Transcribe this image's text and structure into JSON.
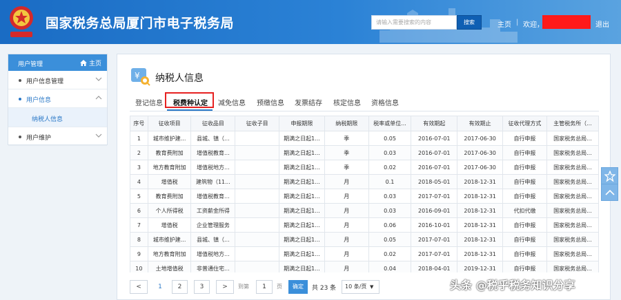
{
  "header": {
    "title": "国家税务总局厦门市电子税务局",
    "search_placeholder": "请输入需要搜索的内容",
    "search_button": "搜索",
    "home_link": "主页",
    "welcome": "欢迎，",
    "logout": "退出",
    "separator": "|"
  },
  "sidebar": {
    "header_label": "用户管理",
    "home_label": "主页",
    "items": [
      {
        "label": "用户信息管理"
      },
      {
        "label": "用户信息"
      },
      {
        "label": "纳税人信息"
      },
      {
        "label": "用户维护"
      }
    ]
  },
  "panel": {
    "title": "纳税人信息",
    "tabs": [
      "登记信息",
      "税费种认定",
      "减免信息",
      "预缴信息",
      "发票结存",
      "核定信息",
      "资格信息"
    ],
    "active_tab": "税费种认定"
  },
  "table": {
    "columns": [
      "序号",
      "征收项目",
      "征收品目",
      "征收子目",
      "申报期限",
      "纳税期限",
      "税率或单位...",
      "有效期起",
      "有效期止",
      "征收代理方式",
      "主管税务所（..."
    ],
    "rows": [
      [
        "1",
        "城市维护建...",
        "县城、镇（...",
        "",
        "期满之日起1...",
        "季",
        "0.05",
        "2016-07-01",
        "2017-06-30",
        "自行申报",
        "国家税务总局..."
      ],
      [
        "2",
        "教育费附加",
        "增值税教育...",
        "",
        "期满之日起1...",
        "季",
        "0.03",
        "2016-07-01",
        "2017-06-30",
        "自行申报",
        "国家税务总局..."
      ],
      [
        "3",
        "地方教育附加",
        "增值税地方...",
        "",
        "期满之日起1...",
        "季",
        "0.02",
        "2016-07-01",
        "2017-06-30",
        "自行申报",
        "国家税务总局..."
      ],
      [
        "4",
        "增值税",
        "建筑物（11...",
        "",
        "期满之日起1...",
        "月",
        "0.1",
        "2018-05-01",
        "2018-12-31",
        "自行申报",
        "国家税务总局..."
      ],
      [
        "5",
        "教育费附加",
        "增值税教育...",
        "",
        "期满之日起1...",
        "月",
        "0.03",
        "2017-07-01",
        "2018-12-31",
        "自行申报",
        "国家税务总局..."
      ],
      [
        "6",
        "个人所得税",
        "工资薪金所得",
        "",
        "期满之日起1...",
        "月",
        "0.03",
        "2016-09-01",
        "2018-12-31",
        "代扣代缴",
        "国家税务总局..."
      ],
      [
        "7",
        "增值税",
        "企业管理服务",
        "",
        "期满之日起1...",
        "月",
        "0.06",
        "2016-10-01",
        "2018-12-31",
        "自行申报",
        "国家税务总局..."
      ],
      [
        "8",
        "城市维护建...",
        "县城、镇（...",
        "",
        "期满之日起1...",
        "月",
        "0.05",
        "2017-07-01",
        "2018-12-31",
        "自行申报",
        "国家税务总局..."
      ],
      [
        "9",
        "地方教育附加",
        "增值税地方...",
        "",
        "期满之日起1...",
        "月",
        "0.02",
        "2017-07-01",
        "2018-12-31",
        "自行申报",
        "国家税务总局..."
      ],
      [
        "10",
        "土地增值税",
        "非普通住宅...",
        "",
        "期满之日起1...",
        "月",
        "0.04",
        "2018-04-01",
        "2019-12-31",
        "自行申报",
        "国家税务总局..."
      ]
    ]
  },
  "pager": {
    "prev": "<",
    "pages": [
      "1",
      "2",
      "3"
    ],
    "current": "1",
    "next": ">",
    "goto_label": "到第",
    "goto_value": "1",
    "page_unit": "页",
    "confirm": "确定",
    "total": "共 23 条",
    "page_size": "10 条/页"
  },
  "watermark": "头条 @税乎税务知识分享",
  "colors": {
    "header_blue": "#1a6cc4",
    "sidebar_head": "#3b8fda",
    "highlight_red": "#e62020",
    "redaction": "#ff1a1a"
  }
}
